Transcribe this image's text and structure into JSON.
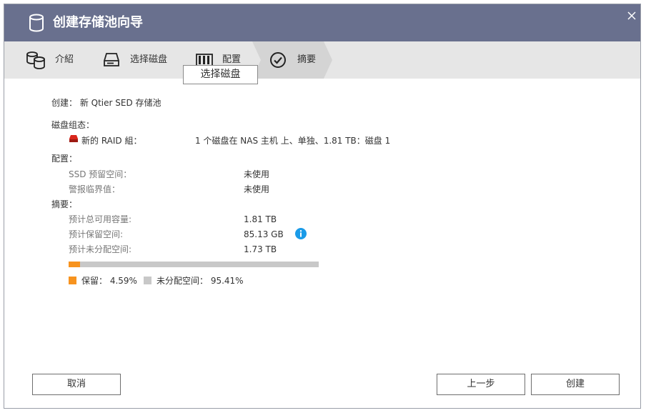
{
  "window": {
    "title": "创建存储池向导",
    "title_icon": "database-icon",
    "close_icon": "close-icon"
  },
  "steps": [
    {
      "label": "介紹",
      "icon": "database-stack-icon"
    },
    {
      "label": "选择磁盘",
      "icon": "disk-drive-icon"
    },
    {
      "label": "配置",
      "icon": "disk-bay-icon"
    },
    {
      "label": "摘要",
      "icon": "check-circle-icon",
      "active": true
    }
  ],
  "tooltip": "选择磁盘",
  "summary": {
    "create_line": "创建： 新 Qtier SED 存储池",
    "disk_group_heading": "磁盘组态：",
    "raid_label": "新的 RAID 組：",
    "raid_value": "1 个磁盘在 NAS 主机 上、单独、1.81 TB：磁盘 1",
    "config_heading": "配置：",
    "ssd_label": "SSD 预留空间：",
    "ssd_value": "未使用",
    "alert_label": "警报临界值：",
    "alert_value": "未使用",
    "summary_heading": "摘要：",
    "total_label": "预计总可用容量:",
    "total_value": "1.81 TB",
    "reserved_label": "预计保留空间:",
    "reserved_value": "85.13 GB",
    "unalloc_label": "预计未分配空间:",
    "unalloc_value": "1.73 TB",
    "reserved_percent": 4.59,
    "legend_reserved": "保留： 4.59%",
    "legend_unalloc": "未分配空间： 95.41%"
  },
  "colors": {
    "titlebar": "#69708e",
    "reserved": "#f7931e",
    "unallocated": "#c8c8c8",
    "info": "#1a9be8",
    "raid_icon": "#d9261c"
  },
  "buttons": {
    "cancel": "取消",
    "back": "上一步",
    "create": "创建"
  }
}
